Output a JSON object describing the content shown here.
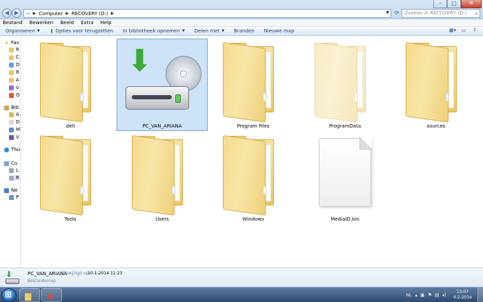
{
  "address_bar": {
    "crumbs": [
      "Computer",
      "RECOVERY (D:)"
    ],
    "search_placeholder": "Zoeken in RECOVERY (D:)"
  },
  "menu": [
    "Bestand",
    "Bewerken",
    "Beeld",
    "Extra",
    "Help"
  ],
  "commands": {
    "organize": "Organiseren",
    "restore": "Opties voor terugzetten",
    "library": "In bibliotheek opnemen",
    "share": "Delen met",
    "burn": "Branden",
    "new_folder": "Nieuwe map"
  },
  "nav": {
    "favorites": "Fav",
    "fav_items": [
      "R",
      "C",
      "D",
      "R",
      "A",
      "o",
      "O"
    ],
    "libraries": "Bib",
    "lib_items": [
      "A",
      "D",
      "M",
      "V"
    ],
    "homegroup": "Thu",
    "computer": "Co",
    "comp_items": [
      "L",
      "R"
    ],
    "network": "Ne",
    "net_items": [
      "P"
    ]
  },
  "items": [
    {
      "name": "dell",
      "kind": "folder"
    },
    {
      "name": "PC_VAN_ARIANA",
      "kind": "drive"
    },
    {
      "name": "Program Files",
      "kind": "folder"
    },
    {
      "name": "ProgramData",
      "kind": "folder-hidden"
    },
    {
      "name": "sources",
      "kind": "folder"
    },
    {
      "name": "Tools",
      "kind": "folder"
    },
    {
      "name": "Users",
      "kind": "folder"
    },
    {
      "name": "Windows",
      "kind": "folder"
    },
    {
      "name": "MediaID.bin",
      "kind": "file"
    }
  ],
  "details": {
    "name": "PC_VAN_ARIANA",
    "modified_label": "Gewijzigd op:",
    "modified_value": "10-1-2014 11:23",
    "type": "Bestandsmap"
  },
  "taskbar": {
    "language": "NL",
    "time": "13:07",
    "date": "4-2-2014"
  }
}
